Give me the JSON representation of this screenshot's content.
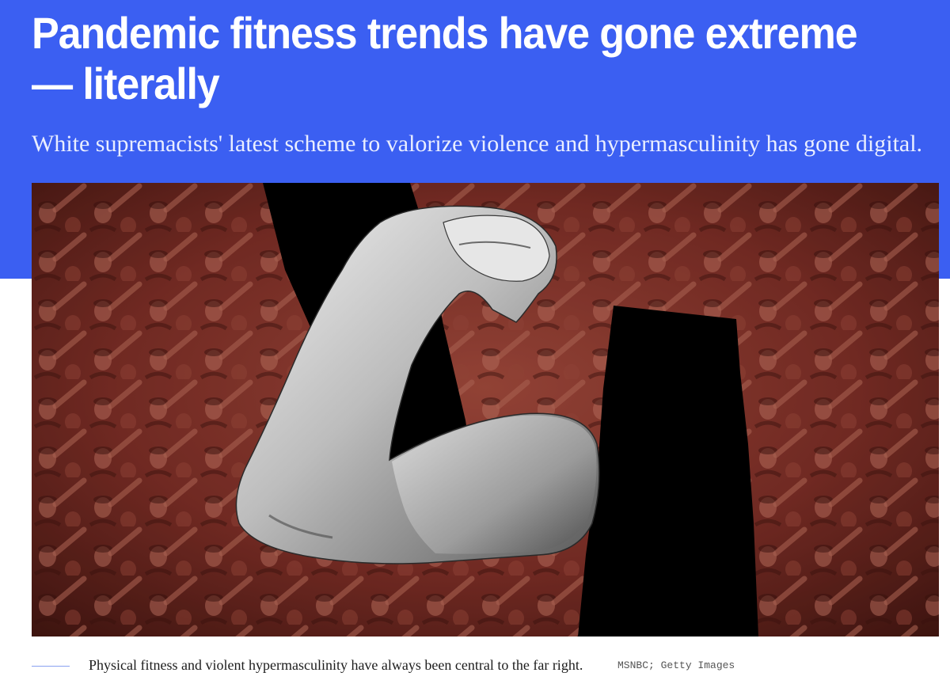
{
  "article": {
    "headline": "Pandemic fitness trends have gone extreme — literally",
    "dek": "White supremacists' latest scheme to valorize violence and hypermasculinity has gone digital.",
    "caption": "Physical fitness and violent hypermasculinity have always been central to the far right.",
    "credit": "MSNBC; Getty Images"
  },
  "theme": {
    "header_color": "#3b5ff2",
    "photo_tint": "#7a2e26"
  },
  "hero_image": {
    "subject": "flexed-bicep-over-crowd-collage"
  }
}
